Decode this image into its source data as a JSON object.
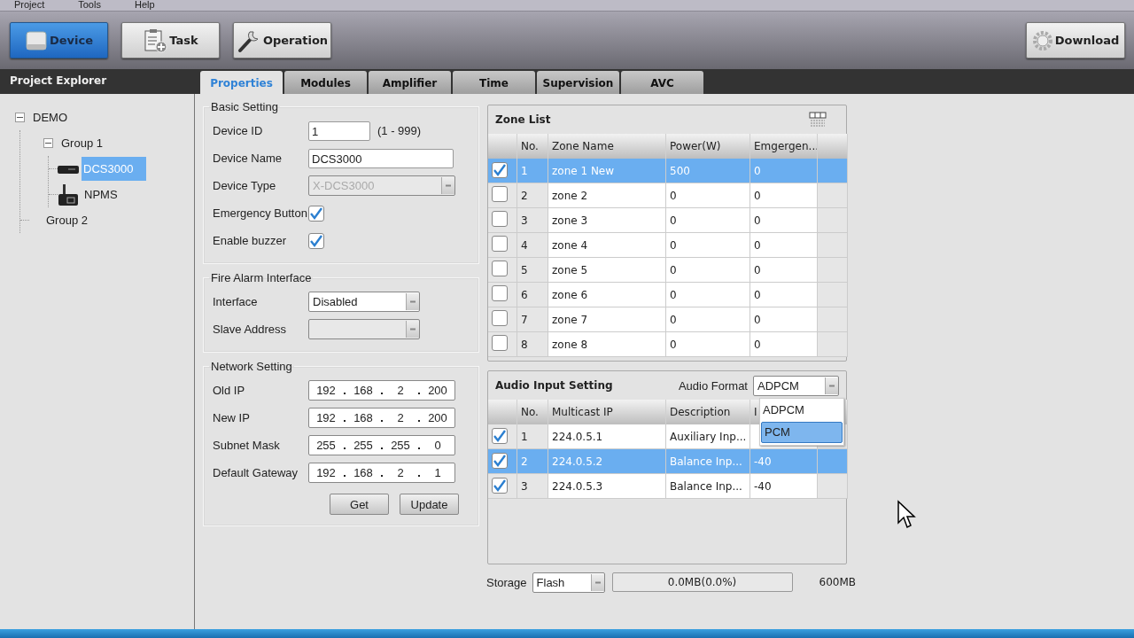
{
  "menu": [
    {
      "label": "Project"
    },
    {
      "label": "Tools"
    },
    {
      "label": "Help"
    }
  ],
  "toolbar": [
    {
      "label": "Device",
      "kind": "drive",
      "selected": true
    },
    {
      "label": "Task",
      "kind": "clipboard",
      "selected": false
    },
    {
      "label": "Operation",
      "kind": "wrench",
      "selected": false
    }
  ],
  "download_button": {
    "label": "Download"
  },
  "project_explorer": {
    "title": "Project Explorer",
    "tree": [
      {
        "label": "DEMO",
        "expanded": true,
        "selected": false,
        "children": [
          {
            "label": "Group 1",
            "expanded": true,
            "selected": false,
            "children": [
              {
                "label": "DCS3000",
                "kind": "rack",
                "selected": true
              },
              {
                "label": "NPMS",
                "kind": "console",
                "selected": false
              }
            ]
          },
          {
            "label": "Group 2",
            "selected": false
          }
        ]
      }
    ]
  },
  "tabs": [
    {
      "label": "Properties",
      "selected": true
    },
    {
      "label": "Modules",
      "selected": false
    },
    {
      "label": "Amplifier",
      "selected": false
    },
    {
      "label": "Time",
      "selected": false
    },
    {
      "label": "Supervision",
      "selected": false
    },
    {
      "label": "AVC",
      "selected": false
    }
  ],
  "basic_setting": {
    "title": "Basic Setting",
    "fields": [
      {
        "label": "Device ID",
        "kind": "text",
        "value": "1",
        "note": "(1 - 999)"
      },
      {
        "label": "Device Name",
        "kind": "text",
        "value": "DCS3000"
      },
      {
        "label": "Device Type",
        "kind": "combo",
        "value": "X-DCS3000",
        "disabled": true
      },
      {
        "label": "Emergency Button",
        "kind": "checkbox",
        "checked": true
      },
      {
        "label": "Enable buzzer",
        "kind": "checkbox",
        "checked": true
      }
    ]
  },
  "fire_alarm_interface": {
    "title": "Fire Alarm Interface",
    "fields": [
      {
        "label": "Interface",
        "kind": "combo",
        "value": "Disabled",
        "disabled": false
      },
      {
        "label": "Slave Address",
        "kind": "combo",
        "disabled": true
      }
    ]
  },
  "network_setting": {
    "title": "Network Setting",
    "fields": [
      {
        "label": "Old IP",
        "octets": [
          "192",
          "168",
          "2",
          "200"
        ]
      },
      {
        "label": "New IP",
        "octets": [
          "192",
          "168",
          "2",
          "200"
        ]
      },
      {
        "label": "Subnet Mask",
        "octets": [
          "255",
          "255",
          "255",
          "0"
        ]
      },
      {
        "label": "Default Gateway",
        "octets": [
          "192",
          "168",
          "2",
          "1"
        ]
      }
    ],
    "buttons": [
      {
        "label": "Get"
      },
      {
        "label": "Update"
      }
    ]
  },
  "zone_list": {
    "title": "Zone List",
    "columns": [
      "No.",
      "Zone Name",
      "Power(W)",
      "Emgergen..."
    ],
    "rows": [
      {
        "checked": true,
        "selected": true,
        "cells": [
          "1",
          "zone 1 New",
          "500",
          "0"
        ]
      },
      {
        "checked": false,
        "selected": false,
        "cells": [
          "2",
          "zone 2",
          "0",
          "0"
        ]
      },
      {
        "checked": false,
        "selected": false,
        "cells": [
          "3",
          "zone 3",
          "0",
          "0"
        ]
      },
      {
        "checked": false,
        "selected": false,
        "cells": [
          "4",
          "zone 4",
          "0",
          "0"
        ]
      },
      {
        "checked": false,
        "selected": false,
        "cells": [
          "5",
          "zone 5",
          "0",
          "0"
        ]
      },
      {
        "checked": false,
        "selected": false,
        "cells": [
          "6",
          "zone 6",
          "0",
          "0"
        ]
      },
      {
        "checked": false,
        "selected": false,
        "cells": [
          "7",
          "zone 7",
          "0",
          "0"
        ]
      },
      {
        "checked": false,
        "selected": false,
        "cells": [
          "8",
          "zone 8",
          "0",
          "0"
        ]
      }
    ]
  },
  "audio_input_setting": {
    "title": "Audio Input Setting",
    "format_label": "Audio Format",
    "format_value": "ADPCM",
    "format_options": [
      {
        "label": "ADPCM",
        "selected": false
      },
      {
        "label": "PCM",
        "selected": true
      }
    ],
    "columns": [
      "No.",
      "Multicast IP",
      "Description",
      "I"
    ],
    "rows": [
      {
        "checked": true,
        "selected": false,
        "cells": [
          "1",
          "224.0.5.1",
          "Auxiliary Inp..."
        ]
      },
      {
        "checked": true,
        "selected": true,
        "cells": [
          "2",
          "224.0.5.2",
          "Balance Inp...",
          "-40"
        ]
      },
      {
        "checked": true,
        "selected": false,
        "cells": [
          "3",
          "224.0.5.3",
          "Balance Inp...",
          "-40"
        ]
      }
    ]
  },
  "storage": {
    "label": "Storage",
    "value": "Flash",
    "usage": "0.0MB(0.0%)",
    "capacity": "600MB"
  }
}
